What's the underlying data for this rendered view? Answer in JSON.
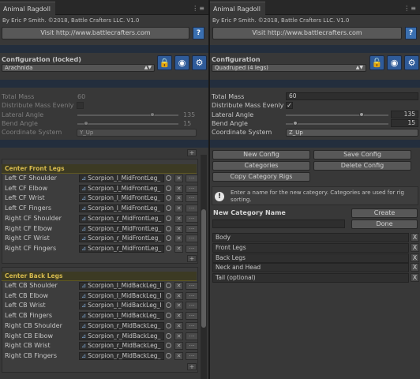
{
  "left": {
    "title": "Animal Ragdoll",
    "author": "By Eric P Smith.  ©2018, Battle Crafters LLC. V1.0",
    "visit_label": "Visit http://www.battlecrafters.com",
    "help_label": "?",
    "config_heading": "Configuration (locked)",
    "config_value": "Arachnida",
    "total_mass_label": "Total Mass",
    "total_mass_value": "60",
    "distribute_label": "Distribute Mass Evenly",
    "distribute_checked": false,
    "lateral_label": "Lateral Angle",
    "lateral_value": "135",
    "bend_label": "Bend Angle",
    "bend_value": "15",
    "coord_label": "Coordinate System",
    "coord_value": "Y_Up",
    "plus": "+",
    "groups": [
      {
        "title": "Center Front Legs",
        "rows": [
          {
            "label": "Left CF Shoulder",
            "value": "Scorpion_l_MidFrontLeg_"
          },
          {
            "label": "Left CF Elbow",
            "value": "Scorpion_l_MidFrontLeg_"
          },
          {
            "label": "Left CF Wrist",
            "value": "Scorpion_l_MidFrontLeg_"
          },
          {
            "label": "Left CF Fingers",
            "value": "Scorpion_l_MidFrontLeg_"
          },
          {
            "label": "Right CF Shoulder",
            "value": "Scorpion_r_MidFrontLeg_"
          },
          {
            "label": "Right CF Elbow",
            "value": "Scorpion_r_MidFrontLeg_"
          },
          {
            "label": "Right CF Wrist",
            "value": "Scorpion_r_MidFrontLeg_"
          },
          {
            "label": "Right CF Fingers",
            "value": "Scorpion_r_MidFrontLeg_"
          }
        ]
      },
      {
        "title": "Center Back Legs",
        "rows": [
          {
            "label": "Left CB Shoulder",
            "value": "Scorpion_l_MidBackLeg_I"
          },
          {
            "label": "Left CB Elbow",
            "value": "Scorpion_l_MidBackLeg_I"
          },
          {
            "label": "Left CB Wrist",
            "value": "Scorpion_l_MidBackLeg_I"
          },
          {
            "label": "Left CB Fingers",
            "value": "Scorpion_l_MidBackLeg_"
          },
          {
            "label": "Right CB Shoulder",
            "value": "Scorpion_r_MidBackLeg_"
          },
          {
            "label": "Right CB Elbow",
            "value": "Scorpion_r_MidBackLeg_"
          },
          {
            "label": "Right CB Wrist",
            "value": "Scorpion_r_MidBackLeg_"
          },
          {
            "label": "Right CB Fingers",
            "value": "Scorpion_r_MidBackLeg_"
          }
        ]
      }
    ]
  },
  "right": {
    "title": "Animal Ragdoll",
    "author": "By Eric P Smith.  ©2018, Battle Crafters LLC. V1.0",
    "visit_label": "Visit http://www.battlecrafters.com",
    "help_label": "?",
    "config_heading": "Configuration",
    "config_value": "Quadruped (4 legs)",
    "total_mass_label": "Total Mass",
    "total_mass_value": "60",
    "distribute_label": "Distribute Mass Evenly",
    "distribute_checked": true,
    "lateral_label": "Lateral Angle",
    "lateral_value": "135",
    "bend_label": "Bend Angle",
    "bend_value": "15",
    "coord_label": "Coordinate System",
    "coord_value": "Z_Up",
    "buttons": {
      "new_config": "New Config",
      "save_config": "Save Config",
      "categories": "Categories",
      "delete_config": "Delete Config",
      "copy_rigs": "Copy Category Rigs"
    },
    "help_message": "Enter a name for the new category.  Categories are used for rig sorting.",
    "new_category_label": "New Category Name",
    "create_label": "Create",
    "done_label": "Done",
    "categories": [
      "Body",
      "Front Legs",
      "Back Legs",
      "Neck and Head",
      "Tail (optional)"
    ],
    "remove_glyph": "X"
  },
  "colors": {
    "accent_blue": "#3a6fb0",
    "group_header_text": "#d5b94d",
    "panel_bg": "#383838"
  },
  "icons": [
    "lock-icon",
    "globe-icon",
    "gear-icon",
    "warning-icon",
    "object-field-icon",
    "target-icon"
  ]
}
